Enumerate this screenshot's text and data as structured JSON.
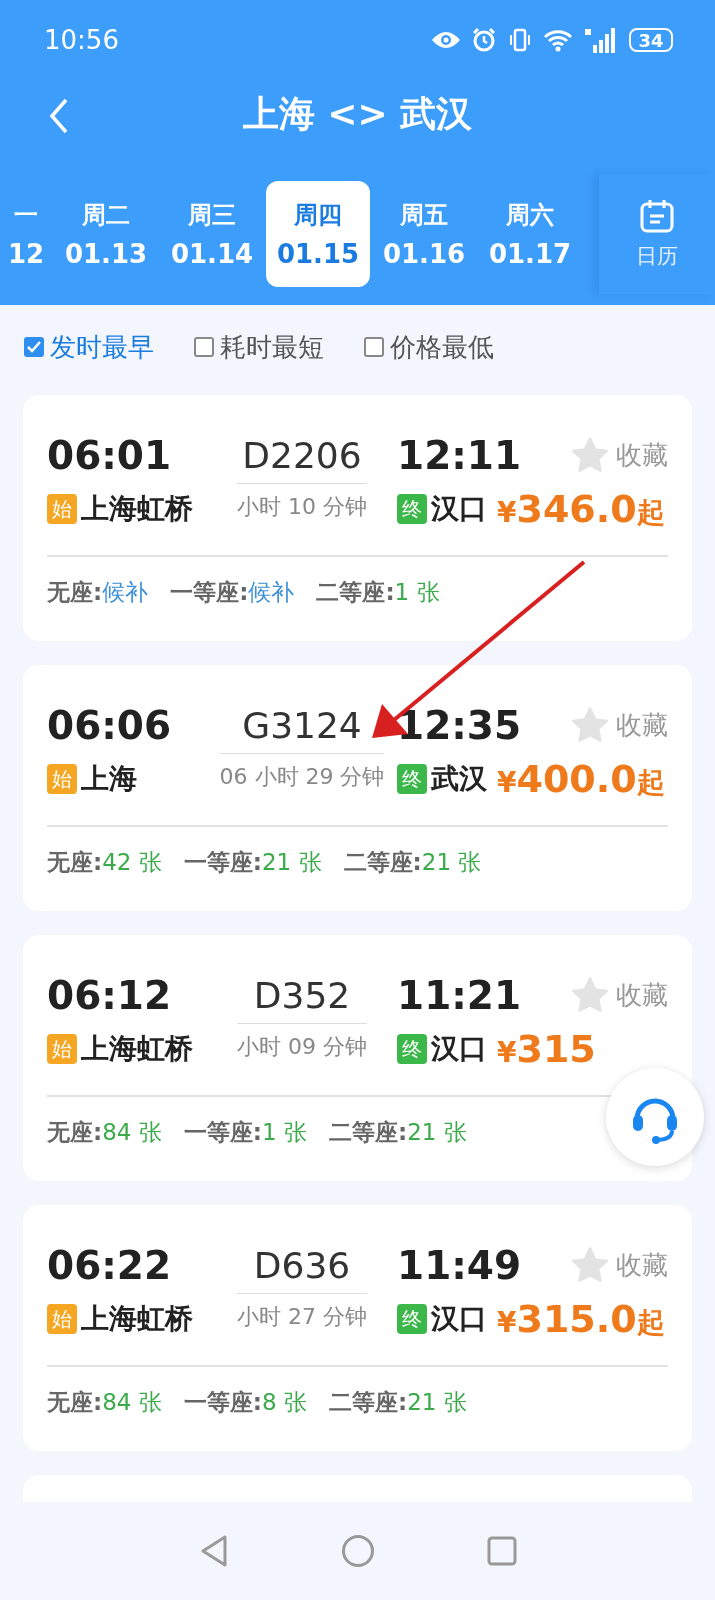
{
  "status_bar": {
    "time": "10:56",
    "battery": "34"
  },
  "header": {
    "title": "上海 <> 武汉"
  },
  "date_tabs": [
    {
      "weekday": "一",
      "date": "12",
      "selected": false
    },
    {
      "weekday": "周二",
      "date": "01.13",
      "selected": false
    },
    {
      "weekday": "周三",
      "date": "01.14",
      "selected": false
    },
    {
      "weekday": "周四",
      "date": "01.15",
      "selected": true
    },
    {
      "weekday": "周五",
      "date": "01.16",
      "selected": false
    },
    {
      "weekday": "周六",
      "date": "01.17",
      "selected": false
    }
  ],
  "calendar_button": {
    "label": "日历"
  },
  "sort_options": [
    {
      "label": "发时最早",
      "checked": true
    },
    {
      "label": "耗时最短",
      "checked": false
    },
    {
      "label": "价格最低",
      "checked": false
    }
  ],
  "trains": [
    {
      "depart": "06:01",
      "number": "D2206",
      "arrive": "12:11",
      "from_badge": "始",
      "from": "上海虹桥",
      "duration": "小时 10 分钟",
      "to_badge": "终",
      "to": "汉口",
      "currency": "¥",
      "price": "346.0",
      "suffix": "起",
      "favorite_label": "收藏",
      "favorited": false,
      "seats": [
        {
          "label": "无座:",
          "value": "候补",
          "kind": "waitlist"
        },
        {
          "label": "一等座:",
          "value": "候补",
          "kind": "waitlist"
        },
        {
          "label": "二等座:",
          "value": "1 张",
          "kind": "tickets"
        }
      ]
    },
    {
      "depart": "06:06",
      "number": "G3124",
      "arrive": "12:35",
      "from_badge": "始",
      "from": "上海",
      "duration": "06 小时 29 分钟",
      "to_badge": "终",
      "to": "武汉",
      "currency": "¥",
      "price": "400.0",
      "suffix": "起",
      "favorite_label": "收藏",
      "favorited": false,
      "seats": [
        {
          "label": "无座:",
          "value": "42 张",
          "kind": "tickets"
        },
        {
          "label": "一等座:",
          "value": "21 张",
          "kind": "tickets"
        },
        {
          "label": "二等座:",
          "value": "21 张",
          "kind": "tickets"
        }
      ]
    },
    {
      "depart": "06:12",
      "number": "D352",
      "arrive": "11:21",
      "from_badge": "始",
      "from": "上海虹桥",
      "duration": "小时 09 分钟",
      "to_badge": "终",
      "to": "汉口",
      "currency": "¥",
      "price": "315",
      "favorite_label": "收藏",
      "favorited": false,
      "seats": [
        {
          "label": "无座:",
          "value": "84 张",
          "kind": "tickets"
        },
        {
          "label": "一等座:",
          "value": "1 张",
          "kind": "tickets"
        },
        {
          "label": "二等座:",
          "value": "21 张",
          "kind": "tickets"
        }
      ]
    },
    {
      "depart": "06:22",
      "number": "D636",
      "arrive": "11:49",
      "from_badge": "始",
      "from": "上海虹桥",
      "duration": "小时 27 分钟",
      "to_badge": "终",
      "to": "汉口",
      "currency": "¥",
      "price": "315.0",
      "suffix": "起",
      "favorite_label": "收藏",
      "favorited": false,
      "seats": [
        {
          "label": "无座:",
          "value": "84 张",
          "kind": "tickets"
        },
        {
          "label": "一等座:",
          "value": "8 张",
          "kind": "tickets"
        },
        {
          "label": "二等座:",
          "value": "21 张",
          "kind": "tickets"
        }
      ]
    }
  ]
}
